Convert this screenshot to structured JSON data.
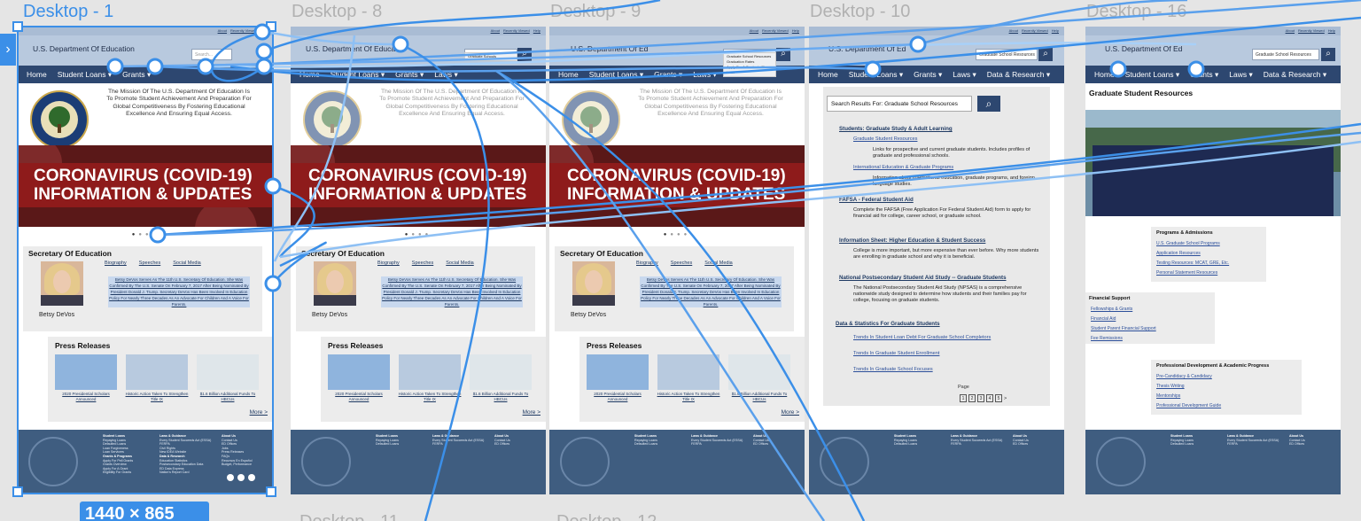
{
  "frame_labels": [
    "Desktop - 1",
    "Desktop - 8",
    "Desktop - 9",
    "Desktop - 10",
    "Desktop - 16"
  ],
  "bottom_labels": [
    "Desktop - 11",
    "Desktop - 12"
  ],
  "size_badge": "1440 × 865",
  "site": {
    "dept_name": "U.S. Department Of Education",
    "dept_name_truncated": "U.S. Department Of Educa",
    "dept_name_short": "U.S. Department Of Ed",
    "top_links": [
      "About",
      "Recently Viewed",
      "Help"
    ],
    "search_placeholder": "Search...",
    "search_typed_1": "Gradua",
    "search_typed_2": "Graduate",
    "search_query_full": "Graduate School Resources",
    "nav": [
      "Home",
      "Student Loans ▾",
      "Grants ▾",
      "Laws ▾",
      "Data & Research ▾"
    ],
    "mission": "The Mission Of The U.S. Department Of Education Is To Promote Student Achievement And Preparation For Global Competitiveness By Fostering Educational Excellence And Ensuring Equal Access.",
    "banner_line1": "CORONAVIRUS (COVID-19)",
    "banner_line2": "INFORMATION & UPDATES",
    "secretary_heading": "Secretary Of Education",
    "secretary_links": [
      "Biography",
      "Speeches",
      "Social Media"
    ],
    "secretary_bio": "Betsy DeVos Serves As The 11th U.S. Secretary Of Education. She Was Confirmed By The U.S. Senate On February 7, 2017 After Being Nominated By President Donald J. Trump. Secretary DeVos Has Been Involved In Education Policy For Nearly Three Decades As An Advocate For Children And A Voice For Parents.",
    "secretary_name": "Betsy DeVos",
    "press_heading": "Press Releases",
    "press_items": [
      "2020 Presidential Scholars Announced",
      "Historic Action Taken To Strengthen Title IX",
      "$1.6 Billion Additional Funds To HBCUs"
    ],
    "more": "More >",
    "footer_cols": [
      {
        "title": "Student Loans",
        "items": [
          "Repaying Loans",
          "Defaulted Loans",
          "Loan Forgiveness",
          "Loan Servicers"
        ]
      },
      {
        "title": "Grants & Programs",
        "items": [
          "Apply For Pell Grants",
          "Grants Overview",
          "Apply For A Grant",
          "Eligibility For Grants"
        ]
      },
      {
        "title": "Laws & Guidance",
        "items": [
          "Every Student Succeeds Act (ESSA)",
          "FERPA",
          "Civil Rights",
          "New IDEA Website"
        ]
      },
      {
        "title": "Data & Research",
        "items": [
          "Education Statistics",
          "Postsecondary Education Data",
          "ED Data Express",
          "Nation's Report Card",
          "What Works Clearinghouse"
        ]
      },
      {
        "title": "About Us",
        "items": [
          "Contact Us",
          "ED Offices",
          "Jobs",
          "Press Releases",
          "FAQs",
          "Recursos En Español",
          "Budget, Performance",
          "Privacy Program",
          "Subscribe To Email Updates"
        ]
      }
    ]
  },
  "dropdown_suggestions_1": [
    "Graduate Schools"
  ],
  "dropdown_suggestions_2": [
    "Graduate School Resources",
    "Graduation Rates",
    "Apply For A Graduate Plus Loan"
  ],
  "results": {
    "heading": "Search Results For: Graduate School Resources",
    "cat1": "Students: Graduate Study & Adult Learning",
    "link1": "Graduate Student Resources",
    "desc1": "Links for prospective and current graduate students. Includes profiles of graduate and professional schools.",
    "link2": "International Education & Graduate Programs",
    "desc2": "Information about international education, graduate programs, and foreign language studies.",
    "cat2": "FAFSA - Federal Student Aid",
    "desc3": "Complete the FAFSA (Free Application For Federal Student Aid) form to apply for financial aid for college, career school, or graduate school.",
    "cat3": "Information Sheet: Higher Education & Student Success",
    "desc4": "College is more important, but more expensive than ever before. Why more students are enrolling in graduate school and why it is beneficial.",
    "cat4": "National Postsecondary Student Aid Study -- Graduate Students",
    "desc5": "The National Postsecondary Student Aid Study (NPSAS) is a comprehensive nationwide study designed to determine how students and their families pay for college, focusing on graduate students.",
    "cat5": "Data & Statistics For Graduate Students",
    "link3": "Trends In Student Loan Debt For Graduate School Completors",
    "link4": "Trends In Graduate Student Enrollment",
    "link5": "Trends In Graduate School Focuses",
    "page_label": "Page",
    "pages": [
      "1",
      "2",
      "3",
      "4",
      "5",
      ">"
    ]
  },
  "grad": {
    "title": "Graduate Student Resources",
    "box1_title": "Programs & Admissions",
    "box1_links": [
      "U.S. Graduate School Programs",
      "Application Resources",
      "Testing Resources: MCAT, GRE, Etc.",
      "Personal Statement Resources"
    ],
    "box2_title": "Financial Support",
    "box2_links": [
      "Fellowships & Grants",
      "Financial Aid",
      "Student Parent Financial Support",
      "Fee Remissions"
    ],
    "box3_title": "Professional Development & Academic Progress",
    "box3_links": [
      "Pre-Candidacy & Candidacy",
      "Thesis Writing",
      "Mentorships",
      "Professional Development Guide"
    ]
  },
  "colors": {
    "accent": "#3b8fe8",
    "nav": "#2d4770",
    "header": "#b8c9de",
    "banner": "#8e1b1b",
    "footer": "#3f5d80"
  }
}
